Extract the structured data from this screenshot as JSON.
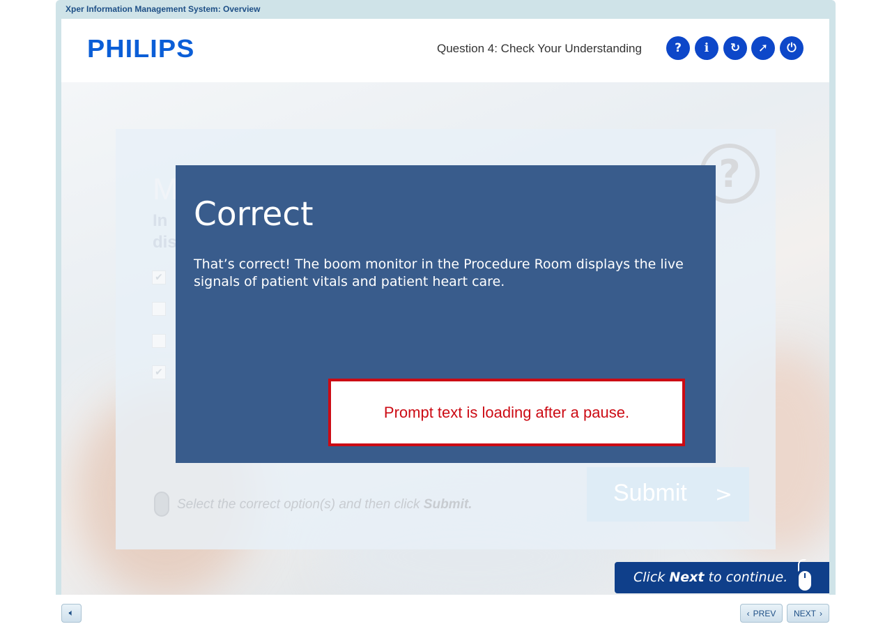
{
  "app": {
    "title": "Xper Information Management System: Overview"
  },
  "header": {
    "logo": "PHILIPS",
    "question_title": "Question 4: Check Your Understanding",
    "buttons": [
      {
        "name": "help",
        "glyph": "?"
      },
      {
        "name": "info",
        "glyph": "i"
      },
      {
        "name": "replay",
        "glyph": "↻"
      },
      {
        "name": "navigate",
        "glyph": "➚"
      },
      {
        "name": "exit",
        "glyph": "⏻"
      }
    ]
  },
  "question_card": {
    "heading": "M",
    "subheading": "In\ndis",
    "instruction_pre": "Select the correct option(s) and then click ",
    "instruction_bold": "Submit.",
    "submit_label": "Submit",
    "submit_arrow": ">",
    "options": [
      {
        "checked": true
      },
      {
        "checked": false
      },
      {
        "checked": false
      },
      {
        "checked": true
      }
    ]
  },
  "feedback": {
    "title": "Correct",
    "text": "That’s correct! The boom monitor in the Procedure Room displays the live signals of patient vitals and patient heart care."
  },
  "prompt": {
    "text": "Prompt text is loading after a pause."
  },
  "next_hint": {
    "pre": "Click ",
    "bold": "Next",
    "post": " to continue."
  },
  "footer": {
    "prev_label": "PREV",
    "next_label": "NEXT"
  },
  "colors": {
    "brand": "#0b5ed7",
    "feedback_bg": "#395c8c",
    "alert": "#cc0b14",
    "nav_blue": "#0f3f8a"
  }
}
